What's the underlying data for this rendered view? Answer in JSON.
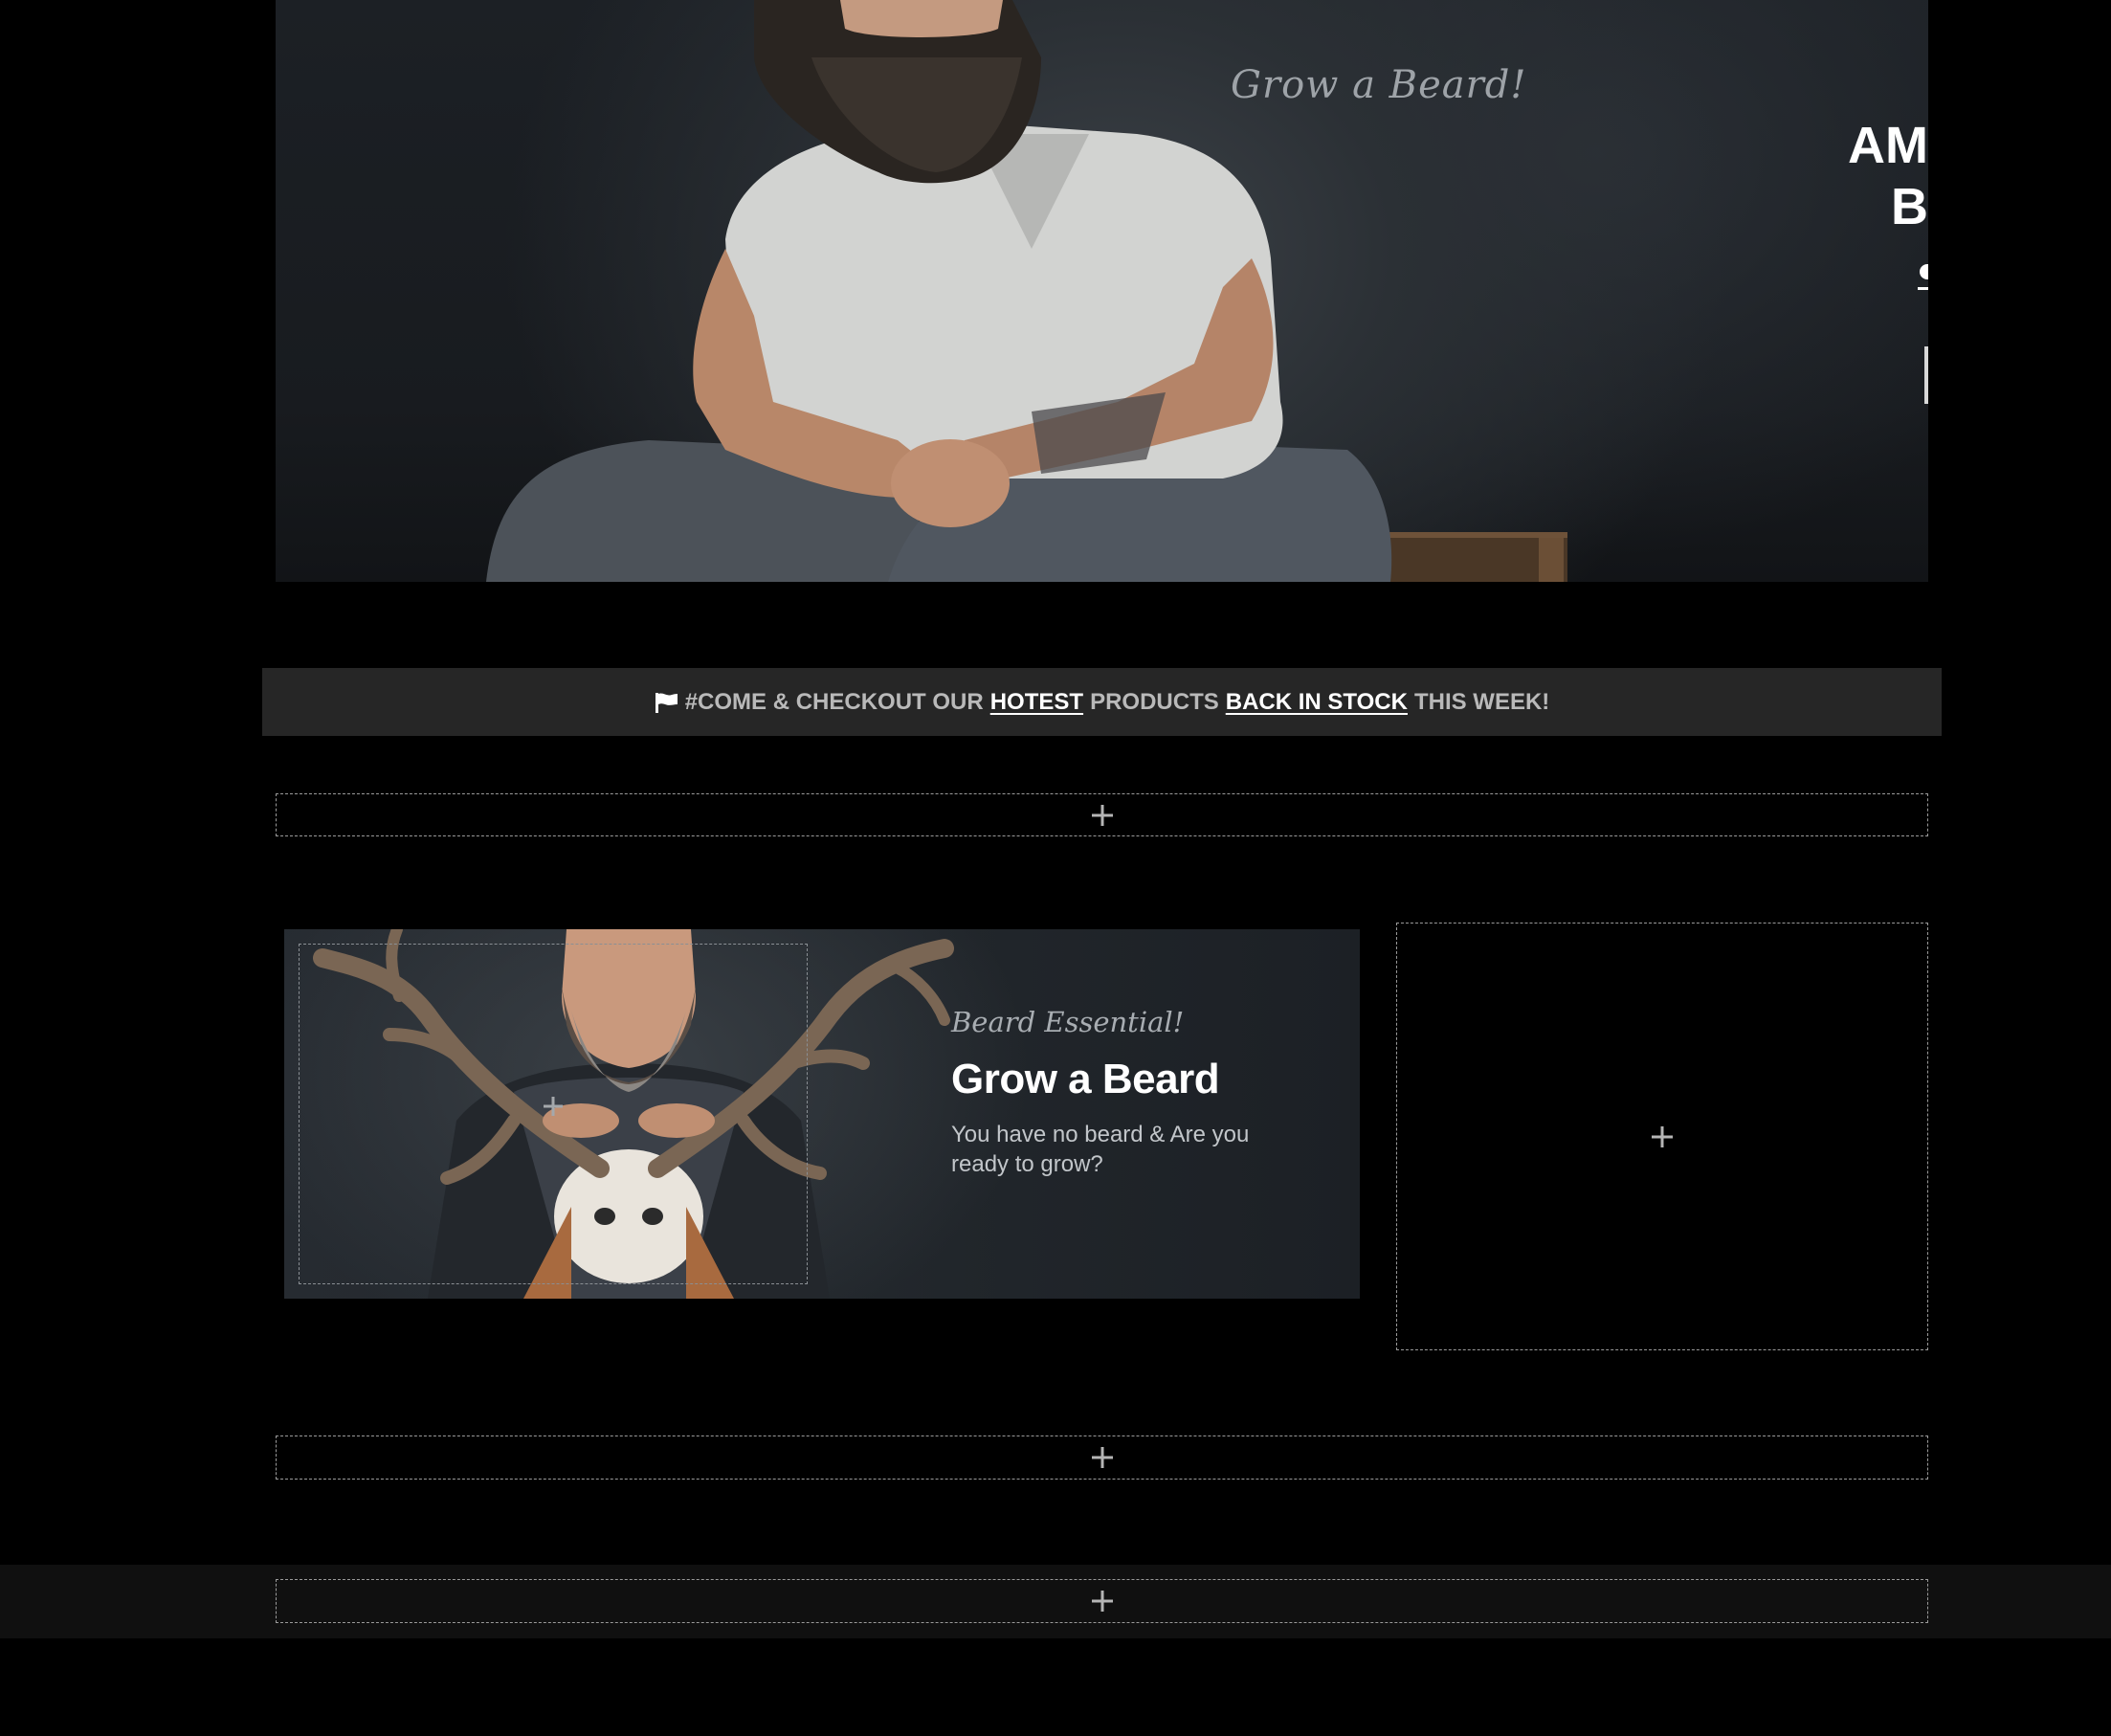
{
  "hero": {
    "tagline": "Grow a Beard!",
    "heading_line1": "AM",
    "heading_line2": "B"
  },
  "announcement": {
    "part1": "#COME & CHECKOUT OUR",
    "link1": "HOTEST",
    "part2": "PRODUCTS",
    "link2": "BACK IN STOCK",
    "part3": "THIS WEEK!"
  },
  "promo": {
    "kicker": "Beard Essential!",
    "title": "Grow a Beard",
    "description": "You have no beard & Are you ready to grow?"
  },
  "icons": {
    "announcement": "flag-icon",
    "add_block": "plus-icon"
  },
  "colors": {
    "background": "#000000",
    "announcement_bar": "#262626",
    "footer_band": "#101010",
    "dashed_border": "#9a9a9a"
  }
}
